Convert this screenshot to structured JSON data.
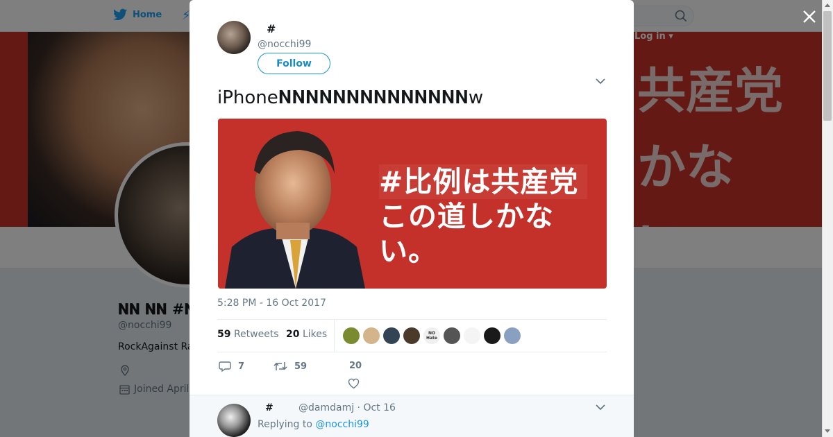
{
  "nav": {
    "home_label": "Home",
    "login_label": "Log in"
  },
  "banner": {
    "line1": "共産党",
    "line2": "かない。"
  },
  "profile": {
    "name": "𝐍𝐍 𝐍𝐍 #𝐍𝐍",
    "handle": "@nocchi99",
    "bio": "RockAgainst Ra",
    "joined": "Joined April"
  },
  "tweet": {
    "author_name": "#",
    "author_handle": "@nocchi99",
    "follow_label": "Follow",
    "text": "iPhone𝐍𝐍𝐍𝐍𝐍𝐍𝐍𝐍𝐍𝐍𝐍𝐍𝐍𝐍w",
    "image_line1": "#比例は共産党",
    "image_line2": "この道しかない。",
    "timestamp": "5:28 PM - 16 Oct 2017",
    "retweets_count": "59",
    "retweets_label": "Retweets",
    "likes_count": "20",
    "likes_label": "Likes",
    "reply_count": "7",
    "retweet_action_count": "59",
    "like_action_count": "20"
  },
  "likers": [
    {
      "color": "#7a8a2e"
    },
    {
      "color": "#d4b48a"
    },
    {
      "color": "#334455"
    },
    {
      "color": "#4a3a2a"
    },
    {
      "color": "#f0f0f0",
      "text": "NO Hate"
    },
    {
      "color": "#555555"
    },
    {
      "color": "#f4f4f4"
    },
    {
      "color": "#1a1a1a"
    },
    {
      "color": "#8aa0c0"
    }
  ],
  "reply": {
    "author_name": "#",
    "author_handle": "@damdamj · Oct 16",
    "replying_prefix": "Replying to",
    "replying_to": "@nocchi99"
  },
  "colors": {
    "twitter_blue": "#1da1f2",
    "follow_blue": "#1b8cbf",
    "banner_red": "#c8322a"
  }
}
